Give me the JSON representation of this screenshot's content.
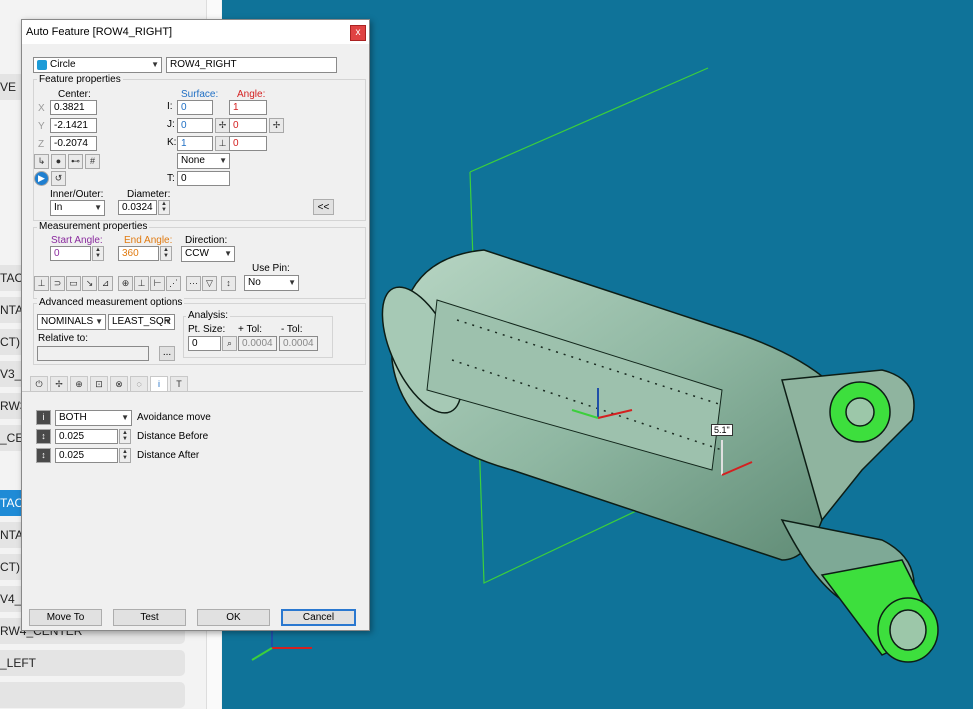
{
  "left_panel": {
    "items": [
      {
        "label": "VE",
        "selected": false
      },
      {
        "label": "TAC",
        "selected": false
      },
      {
        "label": "NTA",
        "selected": false
      },
      {
        "label": "CT)",
        "selected": false
      },
      {
        "label": "V3_F",
        "selected": false
      },
      {
        "label": "RW3_",
        "selected": false
      },
      {
        "label": "_CE",
        "selected": false
      },
      {
        "label": "TAC",
        "selected": true
      },
      {
        "label": "NTA",
        "selected": false
      },
      {
        "label": "CT)",
        "selected": false
      },
      {
        "label": "V4_F",
        "selected": false
      },
      {
        "label": "RW4_CENTER",
        "selected": false
      },
      {
        "label": "_LEFT",
        "selected": false
      }
    ]
  },
  "viewport": {
    "background_color": "#0f7399",
    "dimension_label": "5.1\""
  },
  "dialog": {
    "title": "Auto Feature [ROW4_RIGHT]",
    "close_glyph": "x",
    "feature_type": "Circle",
    "feature_name": "ROW4_RIGHT",
    "feature_properties": {
      "group_title": "Feature properties",
      "center_label": "Center:",
      "x_label": "X",
      "x": "0.3821",
      "y_label": "Y",
      "y": "-2.1421",
      "z_label": "Z",
      "z": "-0.2074",
      "surface_label": "Surface:",
      "angle_label": "Angle:",
      "i_label": "I:",
      "i": "0",
      "ai": "1",
      "j_label": "J:",
      "j": "0",
      "aj": "0",
      "k_label": "K:",
      "k": "1",
      "ak": "0",
      "thickness_mode": "None",
      "t_label": "T:",
      "t": "0",
      "inner_outer_label": "Inner/Outer:",
      "inner_outer": "In",
      "diameter_label": "Diameter:",
      "diameter": "0.0324",
      "collapse_label": "<<"
    },
    "measurement_properties": {
      "group_title": "Measurement properties",
      "start_angle_label": "Start Angle:",
      "start_angle": "0",
      "end_angle_label": "End Angle:",
      "end_angle": "360",
      "direction_label": "Direction:",
      "direction": "CCW",
      "use_pin_label": "Use Pin:",
      "use_pin": "No"
    },
    "advanced": {
      "group_title": "Advanced measurement options",
      "nominals_mode": "NOMINALS",
      "fit_mode": "LEAST_SQR",
      "relative_to_label": "Relative to:",
      "relative_to": "",
      "browse_label": "...",
      "analysis_label": "Analysis:",
      "pt_size_label": "Pt. Size:",
      "pt_size": "0",
      "plus_tol_label": "+ Tol:",
      "plus_tol": "0.0004",
      "minus_tol_label": "- Tol:",
      "minus_tol": "0.0004"
    },
    "avoidance": {
      "mode": "BOTH",
      "mode_label": "Avoidance move",
      "distance_before": "0.025",
      "distance_before_label": "Distance Before",
      "distance_after": "0.025",
      "distance_after_label": "Distance After"
    },
    "buttons": {
      "move_to": "Move To",
      "test": "Test",
      "ok": "OK",
      "cancel": "Cancel"
    },
    "colors": {
      "surface": "#1f6fc4",
      "angle": "#d42020",
      "start_angle": "#8a2b9e",
      "end_angle": "#e07a10",
      "default_button_border": "#2a78d0"
    }
  }
}
